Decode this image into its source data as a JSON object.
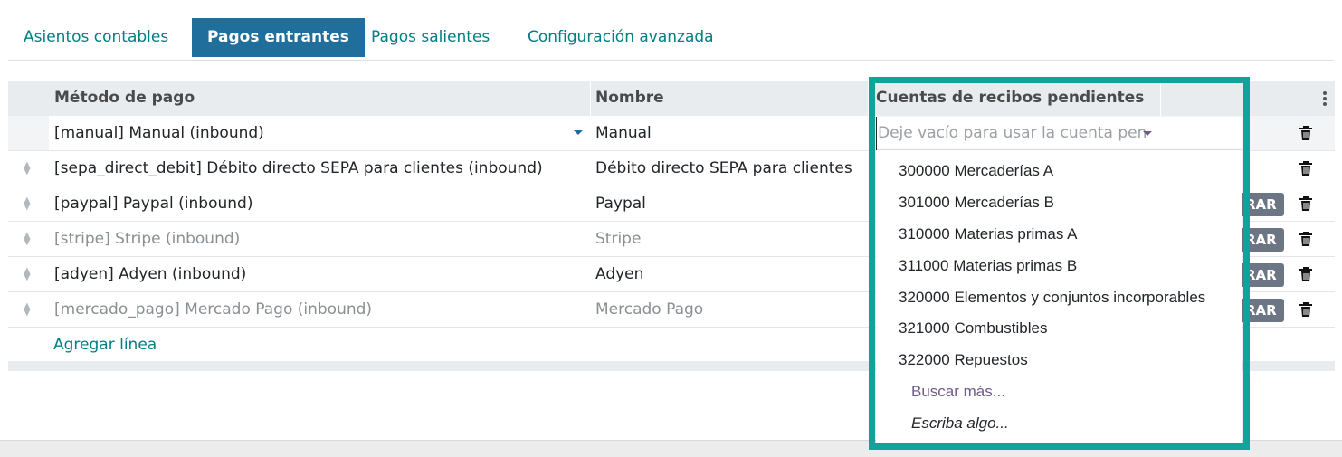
{
  "tabs": [
    {
      "label": "Asientos contables",
      "active": false
    },
    {
      "label": "Pagos entrantes",
      "active": true
    },
    {
      "label": "Pagos salientes",
      "active": false
    },
    {
      "label": "Configuración avanzada",
      "active": false
    }
  ],
  "table": {
    "columns": {
      "method": "Método de pago",
      "name": "Nombre",
      "accounts": "Cuentas de recibos pendientes"
    },
    "edit_row": {
      "method": "[manual] Manual (inbound)",
      "name": "Manual",
      "accounts_placeholder": "Deje vacío para usar la cuenta pen"
    },
    "rows": [
      {
        "method": "[sepa_direct_debit] Débito directo SEPA para clientes (inbound)",
        "name": "Débito directo SEPA para clientes",
        "muted": false,
        "button": ""
      },
      {
        "method": "[paypal] Paypal (inbound)",
        "name": "Paypal",
        "muted": false,
        "button": "RAR"
      },
      {
        "method": "[stripe] Stripe (inbound)",
        "name": "Stripe",
        "muted": true,
        "button": "RAR"
      },
      {
        "method": "[adyen] Adyen (inbound)",
        "name": "Adyen",
        "muted": false,
        "button": "RAR"
      },
      {
        "method": "[mercado_pago] Mercado Pago (inbound)",
        "name": "Mercado Pago",
        "muted": true,
        "button": "RAR"
      }
    ],
    "add_line": "Agregar línea"
  },
  "dropdown": {
    "items": [
      "300000 Mercaderías A",
      "301000 Mercaderías B",
      "310000 Materias primas A",
      "311000 Materias primas B",
      "320000 Elementos y conjuntos incorporables",
      "321000 Combustibles",
      "322000 Repuestos"
    ],
    "search_more": "Buscar más...",
    "type_hint": "Escriba algo..."
  },
  "colors": {
    "accent": "#017e84",
    "active_tab": "#1f6e9c",
    "highlight": "#11a39a"
  }
}
